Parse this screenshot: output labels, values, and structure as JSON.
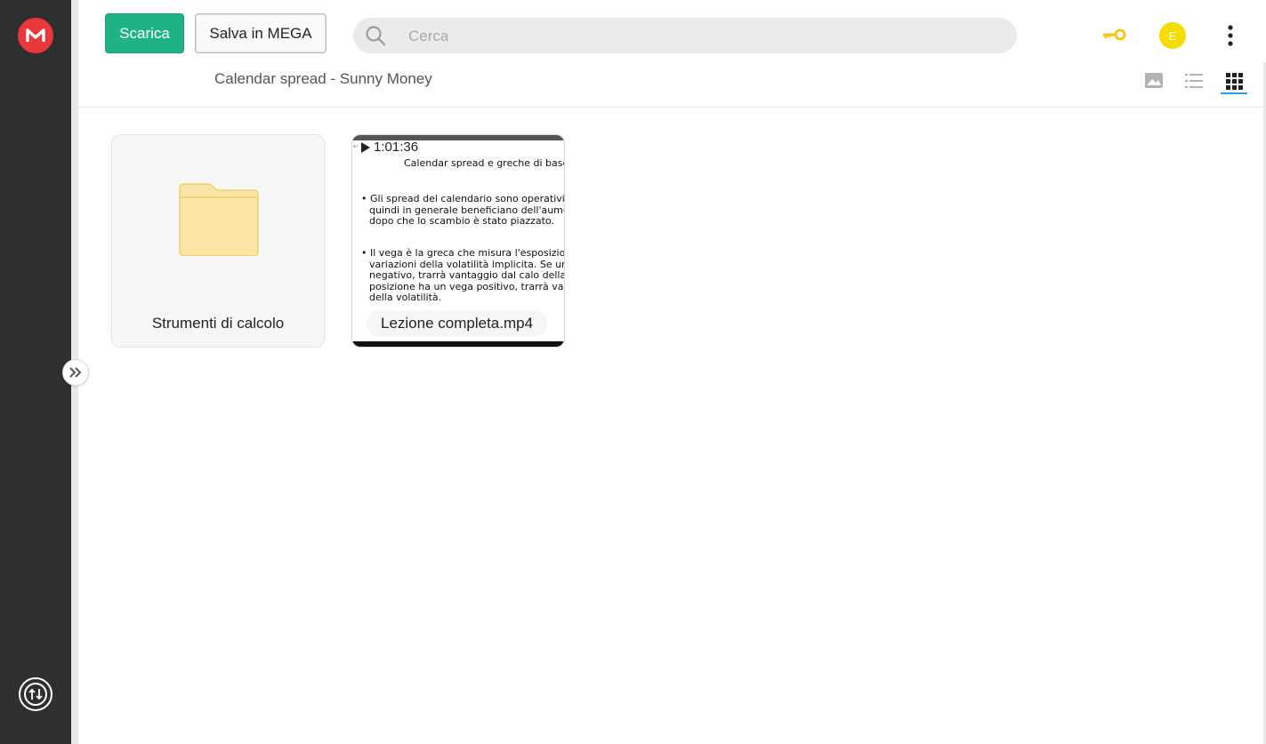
{
  "toolbar": {
    "download_label": "Scarica",
    "save_label": "Salva in MEGA"
  },
  "search": {
    "placeholder": "Cerca",
    "value": ""
  },
  "account": {
    "avatar_initial": "E"
  },
  "breadcrumb": {
    "path": "Calendar spread - Sunny Money"
  },
  "view_modes": [
    "media-view",
    "list-view",
    "grid-view"
  ],
  "active_view": "grid-view",
  "items": [
    {
      "type": "folder",
      "name": "Strumenti di calcolo"
    },
    {
      "type": "video",
      "name": "Lezione completa.mp4",
      "duration": "1:01:36",
      "thumbnail": {
        "title": "Calendar spread e greche di base",
        "bullet_1": [
          "• Gli spread del calendario sono operativi",
          "quindi in generale beneficiano dell'aume",
          "dopo che lo scambio è stato piazzato."
        ],
        "bullet_2": [
          "• Il vega è la greca che misura l'esposizion",
          "variazioni della volatilità implicita.  Se un",
          "negativo, trarrà vantaggio dal calo della",
          "posizione ha un vega positivo, trarrà var",
          "della volatilità."
        ]
      }
    }
  ],
  "colors": {
    "sidebar": "#2f2f2f",
    "brand_red": "#e9373b",
    "download_green": "#1fb284",
    "avatar_yellow": "#f7dc00",
    "key_yellow": "#f5c518",
    "folder_yellow": "#f9e6a6",
    "active_view_blue": "#2aa1e5"
  }
}
